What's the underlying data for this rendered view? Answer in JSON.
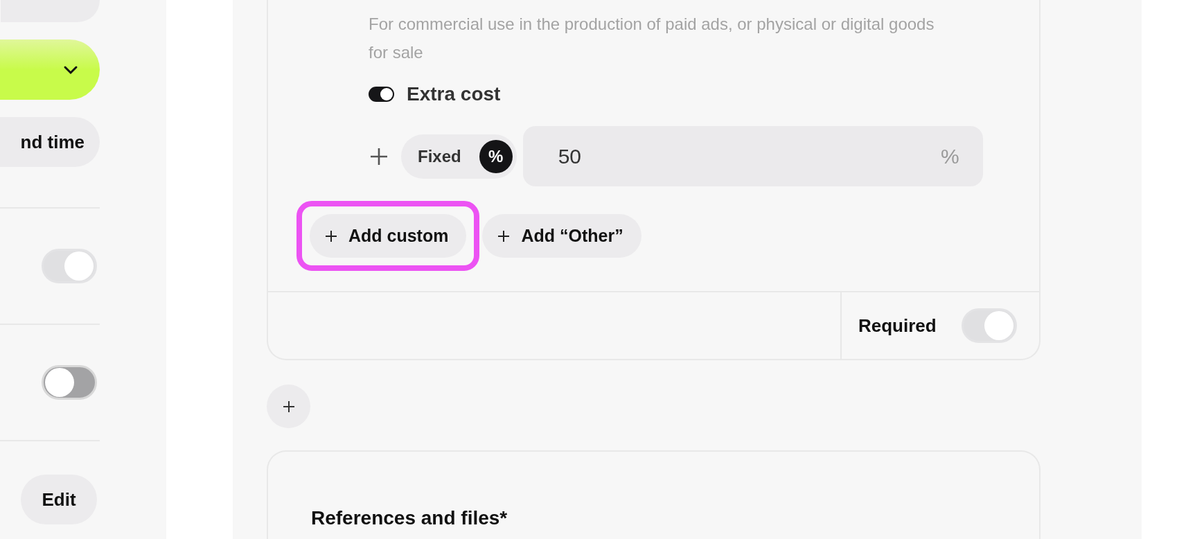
{
  "sidebar": {
    "time_button": {
      "label": "nd time"
    },
    "toggles": [
      {
        "on": true
      },
      {
        "on": false
      }
    ],
    "edit_button": {
      "label": "Edit"
    }
  },
  "option": {
    "description": "For commercial use in the production of paid ads, or physical or digital goods for sale",
    "extra_cost": {
      "label": "Extra cost",
      "on": true
    },
    "cost_type": [
      {
        "label": "Fixed",
        "selected": false
      },
      {
        "label": "%",
        "selected": true
      }
    ],
    "amount": {
      "value": "50",
      "unit": "%"
    },
    "add_buttons": [
      {
        "label": "Add custom",
        "highlighted": true
      },
      {
        "label": "Add “Other”",
        "highlighted": false
      }
    ],
    "required": {
      "label": "Required",
      "on": true
    }
  },
  "references": {
    "title": "References and files*"
  }
}
